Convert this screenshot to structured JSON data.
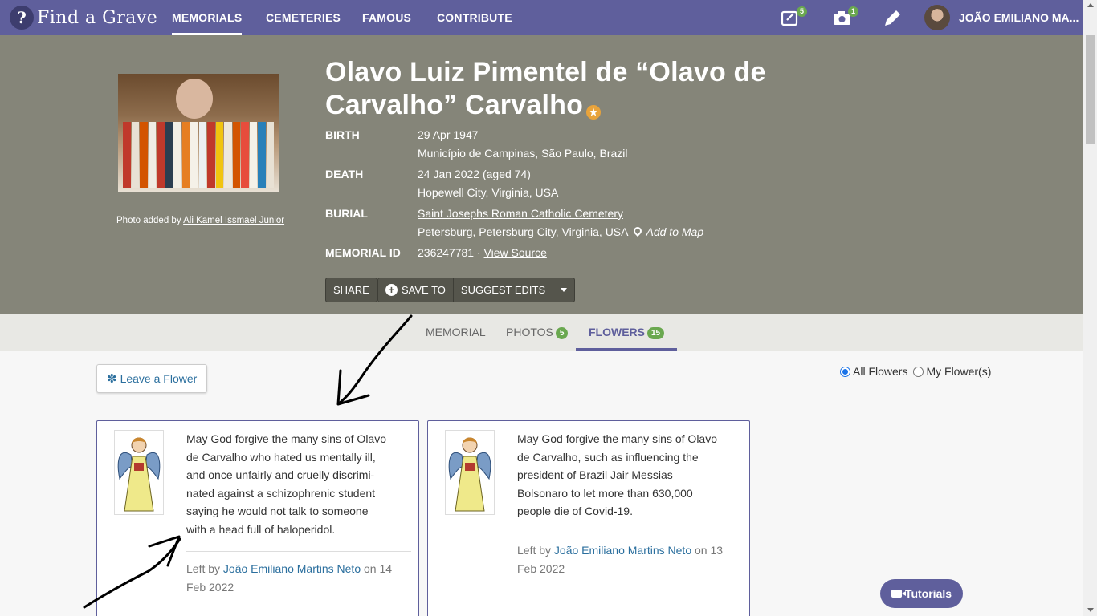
{
  "nav": {
    "brand": "Find a Grave",
    "links": [
      "MEMORIALS",
      "CEMETERIES",
      "FAMOUS",
      "CONTRIBUTE"
    ],
    "notifications_count": "5",
    "photos_count": "1",
    "user_name": "JOÃO EMILIANO MA..."
  },
  "memorial": {
    "name_line1": "Olavo Luiz Pimentel de “Olavo de",
    "name_line2": "Carvalho” Carvalho",
    "photo_credit_prefix": "Photo added by",
    "photo_credit_name": "Ali Kamel Issmael Junior",
    "birth_label": "BIRTH",
    "birth_date": "29 Apr 1947",
    "birth_place": "Município de Campinas, São Paulo, Brazil",
    "death_label": "DEATH",
    "death_date": "24 Jan 2022 (aged 74)",
    "death_place": "Hopewell City, Virginia, USA",
    "burial_label": "BURIAL",
    "burial_cemetery": "Saint Josephs Roman Catholic Cemetery",
    "burial_place": "Petersburg, Petersburg City, Virginia, USA",
    "add_to_map": "Add to Map",
    "id_label": "MEMORIAL ID",
    "memorial_id": "236247781 ·",
    "view_source": "View Source"
  },
  "actions": {
    "share": "SHARE",
    "save_to": "SAVE TO",
    "suggest_edits": "SUGGEST EDITS"
  },
  "tabs": {
    "memorial": "MEMORIAL",
    "photos": "PHOTOS",
    "photos_count": "5",
    "flowers": "FLOWERS",
    "flowers_count": "15"
  },
  "flowers_page": {
    "leave_flower": "Leave a Flower",
    "filter_all": "All Flowers",
    "filter_mine": "My Flower(s)",
    "tutorials": "Tutorials"
  },
  "flowers": [
    {
      "message_lines": [
        "May God forgive the many sins of Olavo",
        "de Carvalho who hated us mentally ill,",
        "and once unfairly and cruelly discrimi-",
        "nated against a schizophrenic student",
        "saying he would not talk to someone",
        "with a head full of haloperidol."
      ],
      "left_by_prefix": "Left by",
      "author": "João Emiliano Martins Neto",
      "date_part1": "on 14",
      "date_part2": "Feb 2022"
    },
    {
      "message_lines": [
        "May God forgive the many sins of Olavo",
        "de Carvalho, such as influencing the",
        "president of Brazil Jair Messias",
        "Bolsonaro to let more than 630,000",
        "people die of Covid-19."
      ],
      "left_by_prefix": "Left by",
      "author": "João Emiliano Martins Neto",
      "date_part1": "on 13",
      "date_part2": "Feb 2022"
    }
  ],
  "colors": {
    "nav": "#5f5f9c",
    "hero": "#858579",
    "link": "#2b6f9e",
    "badge": "#6aa84f"
  }
}
